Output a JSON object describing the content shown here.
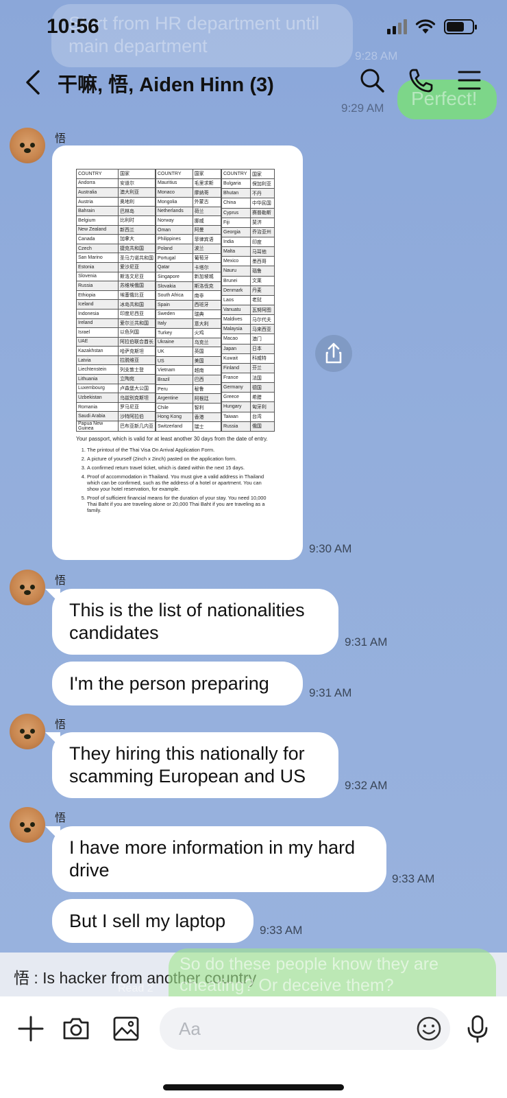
{
  "status_bar": {
    "time": "10:56"
  },
  "background_messages": {
    "ghost_text": "Start from HR department until main department",
    "ghost_time_1": "9:28 AM",
    "ghost_time_2": "9:29 AM",
    "ghost_reply": "Perfect!"
  },
  "header": {
    "title": "干嘛, 悟, Aiden Hinn (3)",
    "back_icon": "chevron-left-icon",
    "icons": [
      "search-icon",
      "phone-icon",
      "menu-icon"
    ]
  },
  "image_message": {
    "time": "9:30 AM",
    "document": {
      "header": [
        "COUNTRY",
        "国家"
      ],
      "col1": [
        [
          "Andorra",
          "安道尔"
        ],
        [
          "Australia",
          "澳大利亚"
        ],
        [
          "Austria",
          "奥地利"
        ],
        [
          "Bahrain",
          "巴林岛"
        ],
        [
          "Belgium",
          "比利时"
        ],
        [
          "New Zealand",
          "新西兰"
        ],
        [
          "Canada",
          "加拿大"
        ],
        [
          "Czech",
          "捷克共和国"
        ],
        [
          "San Marino",
          "圣马力诺共和国"
        ],
        [
          "Estonia",
          "爱沙尼亚"
        ],
        [
          "Slovenia",
          "斯洛文尼亚"
        ],
        [
          "Russia",
          "苏维埃俄国"
        ],
        [
          "Ethiopia",
          "埃塞俄比亚"
        ],
        [
          "Iceland",
          "冰岛共和国"
        ],
        [
          "Indonesia",
          "印度尼西亚"
        ],
        [
          "Ireland",
          "爱尔兰共和国"
        ],
        [
          "Israel",
          "以色列国"
        ],
        [
          "UAE",
          "阿拉伯联合酋长"
        ],
        [
          "Kazakhstan",
          "哈萨克斯坦"
        ],
        [
          "Latvia",
          "拉脱维亚"
        ],
        [
          "Liechtenstein",
          "列支敦士登"
        ],
        [
          "Lithuania",
          "立陶宛"
        ],
        [
          "Luxembourg",
          "卢森堡大公国"
        ],
        [
          "Uzbekistan",
          "乌兹别克斯坦"
        ],
        [
          "Romania",
          "罗马尼亚"
        ],
        [
          "Saudi Arabia",
          "沙特阿拉伯"
        ],
        [
          "Papua New Guinea",
          "巴布亚新几内亚"
        ]
      ],
      "col2": [
        [
          "Mauritius",
          "毛里求斯"
        ],
        [
          "Monaco",
          "摩纳哥"
        ],
        [
          "Mongolia",
          "外蒙古"
        ],
        [
          "Netherlands",
          "荷兰"
        ],
        [
          "Norway",
          "挪威"
        ],
        [
          "Oman",
          "阿曼"
        ],
        [
          "Philippines",
          "菲律宾语"
        ],
        [
          "Poland",
          "波兰"
        ],
        [
          "Portugal",
          "葡萄牙"
        ],
        [
          "Qatar",
          "卡塔尔"
        ],
        [
          "Singapore",
          "新加坡城"
        ],
        [
          "Slovakia",
          "斯洛伐克"
        ],
        [
          "South Africa",
          "南非"
        ],
        [
          "Spain",
          "西班牙"
        ],
        [
          "Sweden",
          "瑞典"
        ],
        [
          "Italy",
          "意大利"
        ],
        [
          "Turkey",
          "火鸡"
        ],
        [
          "Ukraine",
          "乌克兰"
        ],
        [
          "UK",
          "英国"
        ],
        [
          "US",
          "美国"
        ],
        [
          "Vietnam",
          "越南"
        ],
        [
          "Brazil",
          "巴西"
        ],
        [
          "Peru",
          "秘鲁"
        ],
        [
          "Argentine",
          "阿根廷"
        ],
        [
          "Chile",
          "智利"
        ],
        [
          "Hong Kong",
          "香港"
        ],
        [
          "Switzerland",
          "瑞士"
        ]
      ],
      "col3": [
        [
          "Bulgaria",
          "保加利亚"
        ],
        [
          "Bhutan",
          "不丹"
        ],
        [
          "China",
          "中华民国"
        ],
        [
          "Cyprus",
          "赛普勒斯"
        ],
        [
          "Fiji",
          "斐济"
        ],
        [
          "Georgia",
          "乔治亚州"
        ],
        [
          "India",
          "印度"
        ],
        [
          "Malta",
          "马耳他"
        ],
        [
          "Mexico",
          "墨西哥"
        ],
        [
          "Nauru",
          "瑙鲁"
        ],
        [
          "Brunei",
          "文莱"
        ],
        [
          "Denmark",
          "丹麦"
        ],
        [
          "Laos",
          "老挝"
        ],
        [
          "Vanuatu",
          "瓦努阿图"
        ],
        [
          "Maldives",
          "马尔代夫"
        ],
        [
          "Malaysia",
          "马来西亚"
        ],
        [
          "Macao",
          "澳门"
        ],
        [
          "Japan",
          "日本"
        ],
        [
          "Kuwait",
          "科威特"
        ],
        [
          "Finland",
          "芬兰"
        ],
        [
          "France",
          "法国"
        ],
        [
          "Germany",
          "德国"
        ],
        [
          "Greece",
          "希腊"
        ],
        [
          "Hungary",
          "匈牙利"
        ],
        [
          "Taiwan",
          "台湾"
        ],
        [
          "Russia",
          "俄国"
        ]
      ],
      "intro": "Your passport, which is valid for at least another 30 days from the date of entry.",
      "requirements": [
        "The printout of the Thai Visa On Arrival Application Form.",
        "A picture of yourself (2inch x 2inch) pasted on the application form.",
        "A confirmed return travel ticket, which is dated within the next 15 days.",
        "Proof of accommodation in Thailand. You must give a valid address in Thailand which can be confirmed, such as the address of a hotel or apartment. You can show your hotel reservation, for example.",
        "Proof of sufficient financial means for the duration of your stay. You need 10,000 Thai Baht if you are traveling alone or 20,000 Thai Baht if you are traveling as a family."
      ]
    }
  },
  "messages": [
    {
      "sender": "悟",
      "text": "This is the list of nationalities candidates",
      "time": "9:31 AM"
    },
    {
      "sender": "",
      "text": "I'm the person preparing",
      "time": "9:31 AM"
    },
    {
      "sender": "悟",
      "text": "They hiring this nationally for scamming European and US",
      "time": "9:32 AM"
    },
    {
      "sender": "悟",
      "text": "I have more information in my hard drive",
      "time": "9:33 AM"
    },
    {
      "sender": "",
      "text": "But I sell my laptop",
      "time": "9:33 AM"
    }
  ],
  "first_sender": "悟",
  "preview": {
    "text": "悟 : Is hacker from another country",
    "ghost_green_text": "So do these people know they are cheating?   Or deceive them?",
    "ghost_read": "Read 2"
  },
  "input_bar": {
    "placeholder": "Aa",
    "icons": [
      "plus-icon",
      "camera-icon",
      "image-icon",
      "emoji-icon",
      "microphone-icon"
    ]
  }
}
